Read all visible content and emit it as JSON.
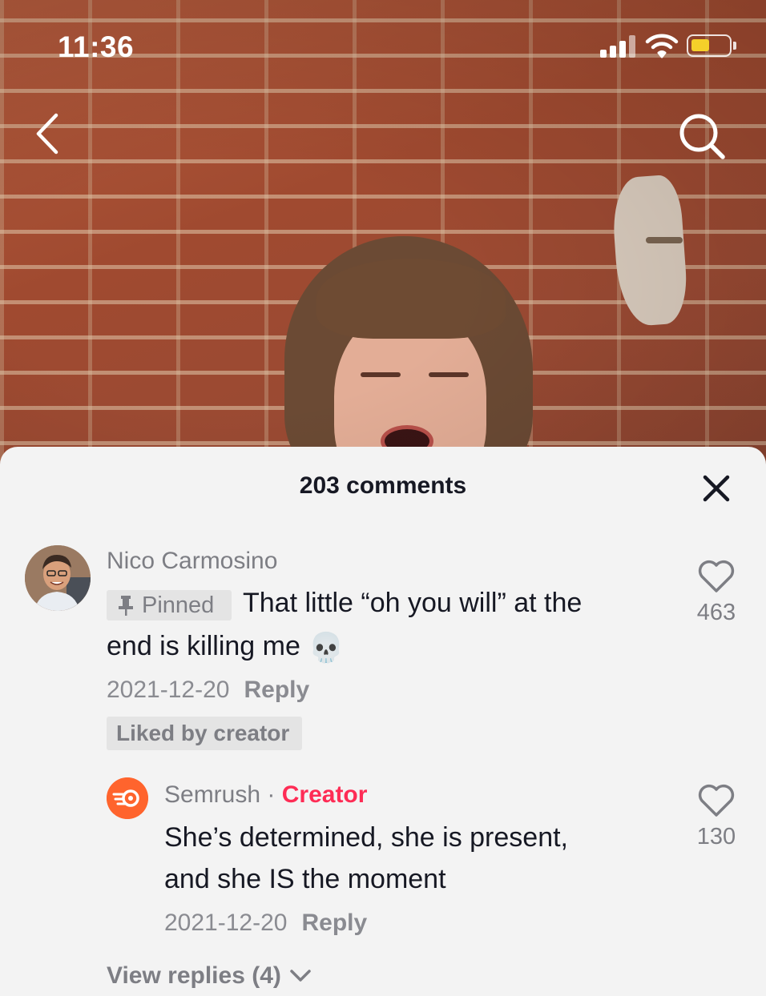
{
  "status_bar": {
    "time": "11:36"
  },
  "comments_sheet": {
    "title": "203 comments",
    "comments": [
      {
        "username": "Nico Carmosino",
        "pinned_label": "Pinned",
        "text_line1": "That little “oh you will” at the",
        "text_line2": "end is killing me",
        "emoji": "💀",
        "date": "2021-12-20",
        "reply_label": "Reply",
        "liked_by_label": "Liked by creator",
        "like_count": "463"
      }
    ],
    "replies": [
      {
        "username": "Semrush",
        "separator": "·",
        "creator_label": "Creator",
        "text_line1": "She’s determined, she is present,",
        "text_line2": "and she IS the moment",
        "date": "2021-12-20",
        "reply_label": "Reply",
        "like_count": "130"
      }
    ],
    "view_replies_label": "View replies (4)"
  },
  "icons": {
    "back": "chevron-left-icon",
    "search": "search-icon",
    "close": "close-icon",
    "like": "heart-outline-icon",
    "pin": "pin-icon",
    "expand": "chevron-down-icon"
  },
  "colors": {
    "sheet_bg": "#f3f3f3",
    "text_primary": "#161823",
    "text_secondary": "#7d7e84",
    "creator_accent": "#fe2c55",
    "semrush_brand": "#ff642d",
    "battery": "#f5d02a"
  }
}
